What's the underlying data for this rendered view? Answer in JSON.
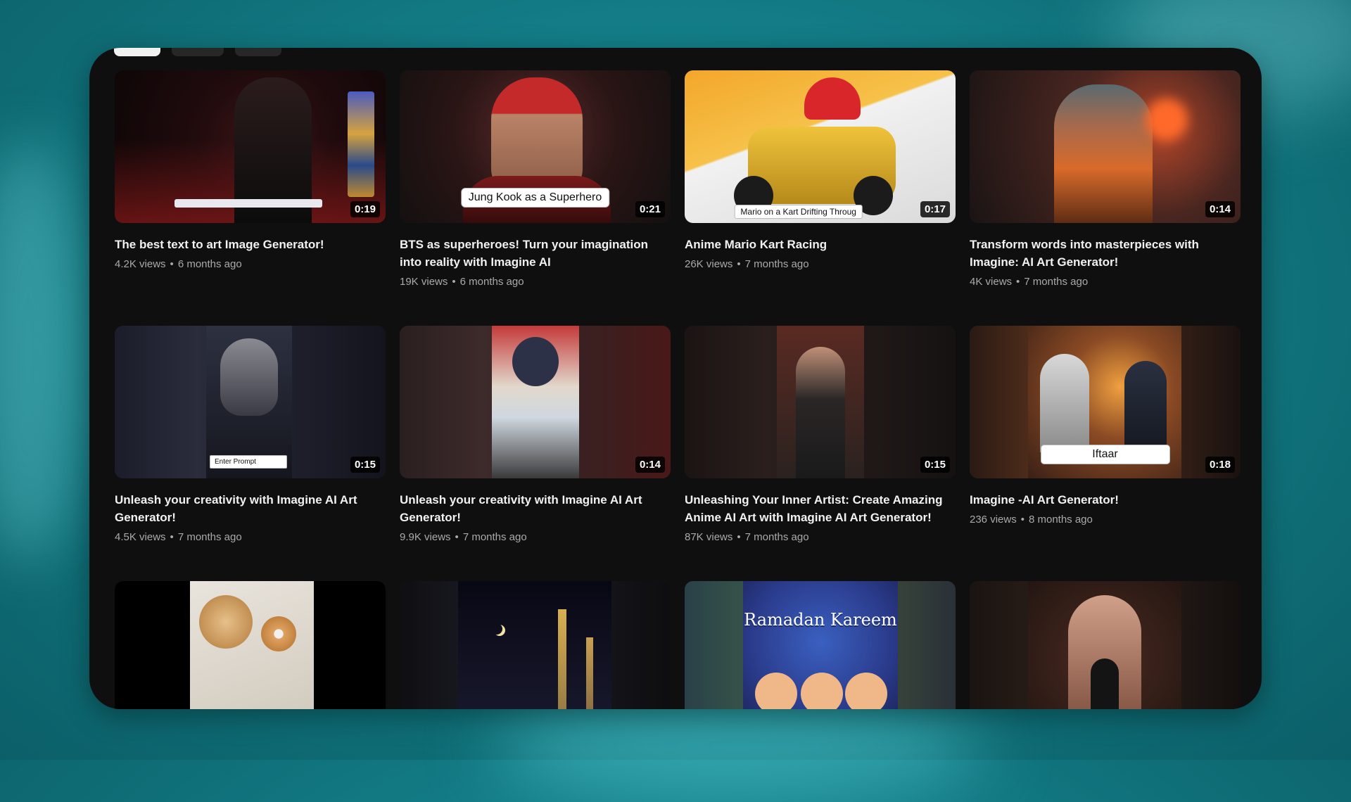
{
  "chips": [
    {
      "label": "",
      "active": true
    },
    {
      "label": "",
      "active": false
    },
    {
      "label": "",
      "active": false
    }
  ],
  "videos": [
    {
      "title": "The best text to art Image Generator!",
      "views": "4.2K views",
      "age": "6 months ago",
      "duration": "0:19",
      "caption": ""
    },
    {
      "title": "BTS as superheroes! Turn your imagination into reality with Imagine AI",
      "views": "19K views",
      "age": "6 months ago",
      "duration": "0:21",
      "caption": "Jung Kook as a Superhero"
    },
    {
      "title": "Anime Mario Kart Racing",
      "views": "26K views",
      "age": "7 months ago",
      "duration": "0:17",
      "caption": "Mario on a Kart Drifting Throug"
    },
    {
      "title": "Transform words into masterpieces with Imagine: AI Art Generator!",
      "views": "4K views",
      "age": "7 months ago",
      "duration": "0:14",
      "caption": ""
    },
    {
      "title": "Unleash your creativity with Imagine AI Art Generator!",
      "views": "4.5K views",
      "age": "7 months ago",
      "duration": "0:15",
      "caption": "Enter Prompt"
    },
    {
      "title": "Unleash your creativity with Imagine AI Art Generator!",
      "views": "9.9K views",
      "age": "7 months ago",
      "duration": "0:14",
      "caption": ""
    },
    {
      "title": "Unleashing Your Inner Artist: Create Amazing Anime AI Art with Imagine AI Art Generator!",
      "views": "87K views",
      "age": "7 months ago",
      "duration": "0:15",
      "caption": ""
    },
    {
      "title": "Imagine -AI Art Generator!",
      "views": "236 views",
      "age": "8 months ago",
      "duration": "0:18",
      "caption": "Iftaar"
    }
  ],
  "row3_thumbs": [
    {
      "overlay": ""
    },
    {
      "overlay": ""
    },
    {
      "overlay": "Ramadan Kareem"
    },
    {
      "overlay": ""
    }
  ],
  "separator": "•"
}
